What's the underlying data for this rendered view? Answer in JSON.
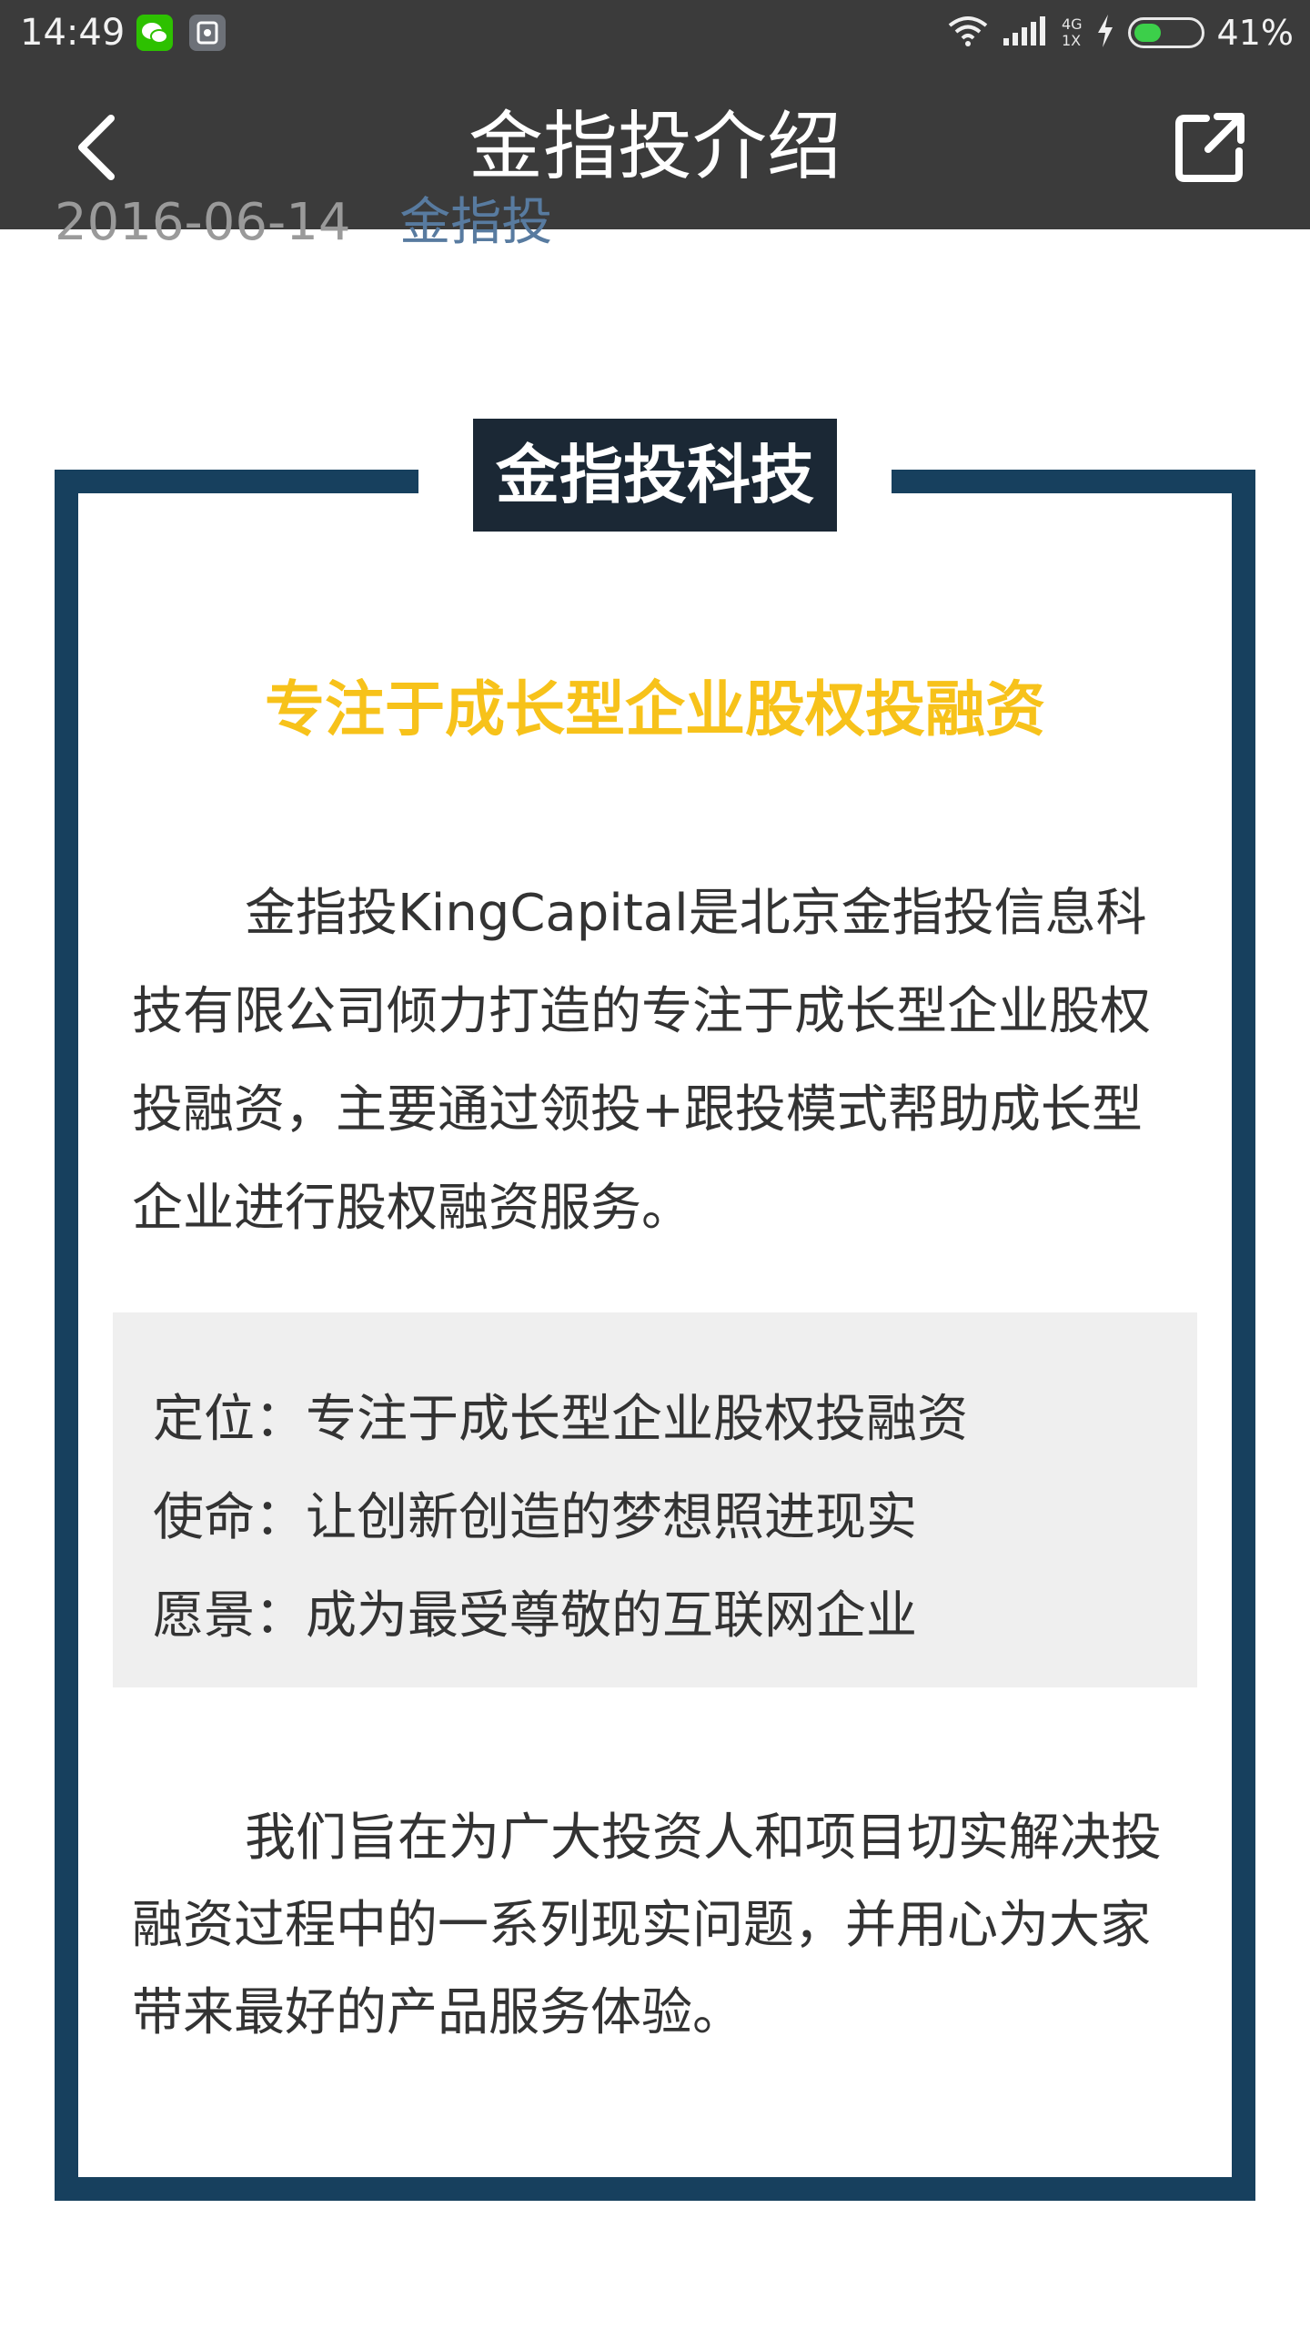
{
  "status_bar": {
    "time": "14:49",
    "network_top": "4G",
    "network_bottom": "1X",
    "battery_percent": "41%",
    "battery_level": 0.41,
    "icons": [
      "wechat-icon",
      "notification-icon",
      "wifi-icon",
      "signal-icon",
      "charging-icon",
      "battery-icon"
    ]
  },
  "header": {
    "title": "金指投介绍",
    "back_icon": "chevron-left-icon",
    "share_icon": "external-link-icon"
  },
  "article": {
    "date": "2016-06-14",
    "author": "金指投",
    "badge_title": "金指投科技",
    "slogan": "专注于成长型企业股权投融资",
    "intro": "金指投KingCapital是北京金指投信息科技有限公司倾力打造的专注于成长型企业股权投融资，主要通过领投+跟投模式帮助成长型企业进行股权融资服务。",
    "info": [
      "定位：专注于成长型企业股权投融资",
      "使命：让创新创造的梦想照进现实",
      "愿景：成为最受尊敬的互联网企业"
    ],
    "closing": "我们旨在为广大投资人和项目切实解决投融资过程中的一系列现实问题，并用心为大家带来最好的产品服务体验。"
  },
  "colors": {
    "header_bg": "#3b3b3b",
    "frame": "#17405e",
    "badge_bg": "#1b2835",
    "slogan": "#f7c21a",
    "info_bg": "#efefef",
    "author_link": "#587ba0"
  }
}
